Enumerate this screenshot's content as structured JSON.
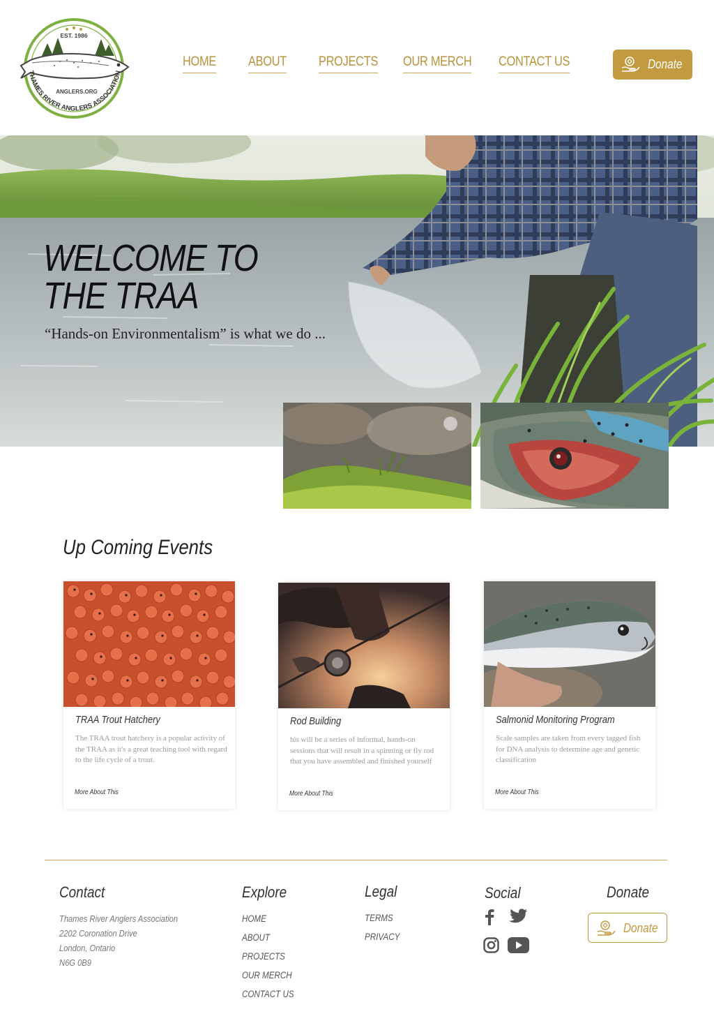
{
  "logo": {
    "est": "EST. 1986",
    "site": "ANGLERS.ORG",
    "name": "THAMES RIVER ANGLERS ASSOCIATION"
  },
  "nav": {
    "items": [
      {
        "label": "HOME"
      },
      {
        "label": "ABOUT"
      },
      {
        "label": "PROJECTS"
      },
      {
        "label": "OUR MERCH"
      },
      {
        "label": "CONTACT US"
      }
    ],
    "donate_label": "Donate"
  },
  "hero": {
    "title_line1": "WELCOME TO",
    "title_line2": "THE TRAA",
    "subtitle": "“Hands-on Environmentalism” is what we do ..."
  },
  "events": {
    "heading": "Up Coming Events",
    "cards": [
      {
        "title": "TRAA Trout Hatchery",
        "text": "The TRAA trout hatchery is a popular activity of the TRAA as it's a great teaching tool with regard to the life cycle of a trout.",
        "more": "More About This"
      },
      {
        "title": "Rod Building",
        "text": "his will be a series of informal, hands-on sessions that will result in a spinning or fly rod that you have assembled and finished yourself",
        "more": "More About This"
      },
      {
        "title": "Salmonid Monitoring Program",
        "text": "Scale samples are taken from every tagged fish for DNA analysis to determine age and genetic classification",
        "more": "More About This"
      }
    ]
  },
  "footer": {
    "contact": {
      "heading": "Contact",
      "lines": [
        "Thames River Anglers Association",
        "2202 Coronation Drive",
        "London, Ontario",
        "N6G 0B9"
      ]
    },
    "explore": {
      "heading": "Explore",
      "links": [
        "HOME",
        "ABOUT",
        "PROJECTS",
        "OUR MERCH",
        "CONTACT US"
      ]
    },
    "legal": {
      "heading": "Legal",
      "links": [
        "TERMS",
        "PRIVACY"
      ]
    },
    "social": {
      "heading": "Social",
      "icons": [
        "facebook-icon",
        "twitter-icon",
        "instagram-icon",
        "youtube-icon"
      ]
    },
    "donate": {
      "heading": "Donate",
      "label": "Donate"
    }
  },
  "colors": {
    "accent": "#c29a3f",
    "logo_green": "#7db040",
    "text_dark": "#222222"
  }
}
